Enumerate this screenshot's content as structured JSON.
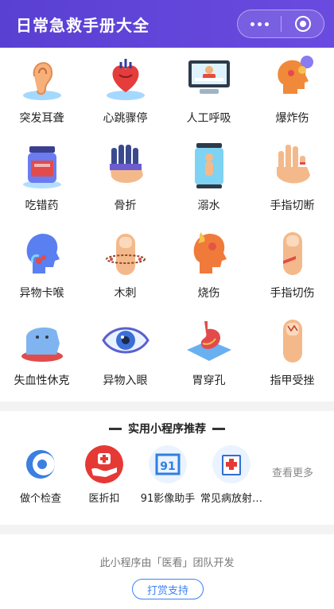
{
  "header": {
    "title": "日常急救手册大全"
  },
  "items": [
    {
      "label": "突发耳聋",
      "icon": "ear-icon"
    },
    {
      "label": "心跳骤停",
      "icon": "heart-icon"
    },
    {
      "label": "人工呼吸",
      "icon": "cpr-icon"
    },
    {
      "label": "爆炸伤",
      "icon": "explosion-head-icon"
    },
    {
      "label": "吃错药",
      "icon": "medicine-jar-icon"
    },
    {
      "label": "骨折",
      "icon": "broken-hand-icon"
    },
    {
      "label": "溺水",
      "icon": "drowning-icon"
    },
    {
      "label": "手指切断",
      "icon": "cut-finger-hand-icon"
    },
    {
      "label": "异物卡喉",
      "icon": "choking-head-icon"
    },
    {
      "label": "木刺",
      "icon": "splinter-finger-icon"
    },
    {
      "label": "烧伤",
      "icon": "burn-head-icon"
    },
    {
      "label": "手指切伤",
      "icon": "finger-cut-icon"
    },
    {
      "label": "失血性休克",
      "icon": "blood-shock-icon"
    },
    {
      "label": "异物入眼",
      "icon": "eye-icon"
    },
    {
      "label": "胃穿孔",
      "icon": "stomach-icon"
    },
    {
      "label": "指甲受挫",
      "icon": "nail-injury-icon"
    }
  ],
  "recommend": {
    "title": "实用小程序推荐",
    "apps": [
      {
        "label": "做个检查",
        "icon": "checkup-app-icon"
      },
      {
        "label": "医折扣",
        "icon": "medical-discount-app-icon"
      },
      {
        "label": "91影像助手",
        "icon": "imaging-91-app-icon"
      },
      {
        "label": "常见病放射…",
        "icon": "radiology-book-app-icon"
      }
    ],
    "more": "查看更多"
  },
  "footer": {
    "credit": "此小程序由「医看」团队开发",
    "support_button": "打赏支持"
  },
  "colors": {
    "header": "#5a3fd3",
    "accent": "#3b82f6"
  }
}
